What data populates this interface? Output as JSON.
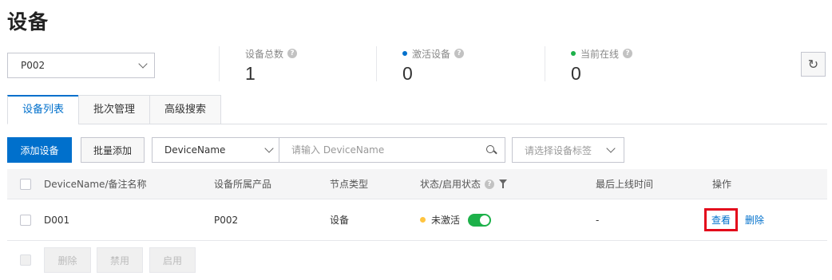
{
  "page_title": "设备",
  "product_select": {
    "value": "P002"
  },
  "stats": [
    {
      "label": "设备总数",
      "value": "1",
      "dot_color": ""
    },
    {
      "label": "激活设备",
      "value": "0",
      "dot_color": "#0070cc"
    },
    {
      "label": "当前在线",
      "value": "0",
      "dot_color": "#1db14a"
    }
  ],
  "refresh_icon": "refresh-icon",
  "tabs": [
    {
      "label": "设备列表",
      "active": true
    },
    {
      "label": "批次管理",
      "active": false
    },
    {
      "label": "高级搜索",
      "active": false
    }
  ],
  "toolbar": {
    "add_device": "添加设备",
    "batch_add": "批量添加",
    "field_select": "DeviceName",
    "search_placeholder": "请输入 DeviceName",
    "tag_placeholder": "请选择设备标签"
  },
  "table": {
    "headers": {
      "device_name": "DeviceName/备注名称",
      "product": "设备所属产品",
      "node_type": "节点类型",
      "status": "状态/启用状态",
      "last_online": "最后上线时间",
      "actions": "操作"
    },
    "rows": [
      {
        "device_name": "D001",
        "product": "P002",
        "node_type": "设备",
        "status": "未激活",
        "status_color": "#ffc440",
        "enabled": true,
        "last_online": "-",
        "view": "查看",
        "delete": "删除"
      }
    ]
  },
  "batch_actions": {
    "delete": "删除",
    "disable": "禁用",
    "enable": "启用"
  },
  "colors": {
    "primary": "#0070cc",
    "highlight": "#e3071b",
    "online": "#1db14a",
    "inactive": "#ffc440"
  }
}
